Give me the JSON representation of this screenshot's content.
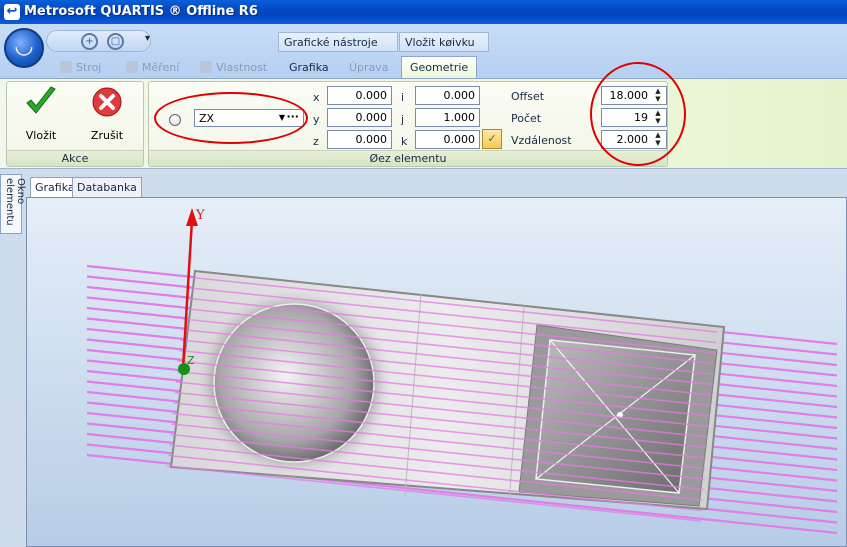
{
  "window": {
    "title": "Metrosoft QUARTIS ® Offline R6"
  },
  "quick_access": {
    "menu_arrow": "▾"
  },
  "context_groups": {
    "graphics_tools": "Grafické nástroje",
    "insert_curve": "Vložit køivku"
  },
  "tabs": [
    {
      "label": "Stroj"
    },
    {
      "label": "Měření"
    },
    {
      "label": "Vlastnost"
    },
    {
      "label": "Grafika"
    },
    {
      "label": "Úprava"
    },
    {
      "label": "Geometrie"
    }
  ],
  "actions_group": {
    "label": "Akce",
    "insert_label": "Vložit",
    "cancel_label": "Zrušit"
  },
  "section_group": {
    "label": "Øez elementu",
    "plane_value": "ZX",
    "x_label": "x",
    "x_value": "0.000",
    "y_label": "y",
    "y_value": "0.000",
    "z_label": "z",
    "z_value": "0.000",
    "i_label": "i",
    "i_value": "0.000",
    "j_label": "j",
    "j_value": "1.000",
    "k_label": "k",
    "k_value": "0.000",
    "offset_label": "Offset",
    "offset_value": "18.000",
    "count_label": "Počet",
    "count_value": "19",
    "distance_label": "Vzdálenost",
    "distance_value": "2.000"
  },
  "side_panel": {
    "label": "Okno elementu"
  },
  "view_tabs": [
    {
      "label": "Grafika"
    },
    {
      "label": "Databanka"
    }
  ],
  "viewport": {
    "axis_y_label": "Y",
    "axis_z_label": "Z"
  },
  "colors": {
    "accent": "#0449c4",
    "section_lines": "#e27ce8",
    "annotation": "#e00000"
  }
}
